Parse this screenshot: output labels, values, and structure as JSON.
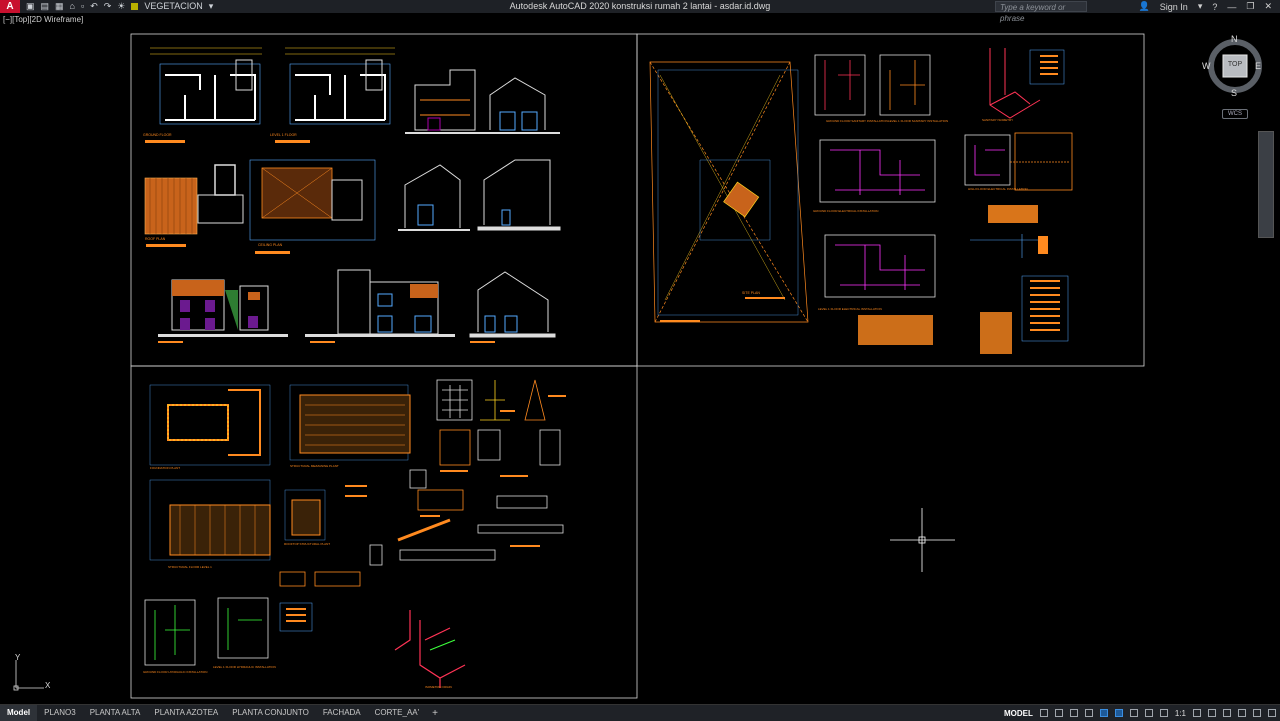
{
  "titlebar": {
    "app_letter": "A",
    "layer_name": "VEGETACION",
    "title": "Autodesk AutoCAD 2020    konstruksi rumah 2 lantai - asdar.id.dwg",
    "search_placeholder": "Type a keyword or phrase",
    "sign_in": "Sign In",
    "quick_access": [
      "▣",
      "▤",
      "▦",
      "⌂",
      "▫",
      "↶",
      "↷",
      "☀"
    ]
  },
  "viewport": {
    "label": "[−][Top][2D Wireframe]"
  },
  "viewcube": {
    "north": "N",
    "south": "S",
    "east": "E",
    "west": "W",
    "face": "TOP",
    "wcs": "WCS"
  },
  "ucs": {
    "x": "X",
    "y": "Y"
  },
  "sheet_labels": {
    "ground_floor": "GROUND FLOOR",
    "level1_floor": "LEVEL 1 FLOOR",
    "roof_plan": "ROOF PLAN",
    "ceiling_plan": "CEILING PLAN",
    "site_plan": "SITE PLAN",
    "gf_sanitary": "GROUND FLOOR SANITARY INSTALLATION",
    "l1_sanitary": "LEVEL 1 FLOOR SANITARY INSTALLATION",
    "gf_electrical": "GROUND FLOOR ELECTRICAL INSTALLATION",
    "l1_electrical": "LEVEL 1 FLOOR ELECTRICAL INSTALLATION",
    "hi_floor_electrical": "HIGH FLOOR ELECTRICAL INSTALLATION",
    "sanitary_iso": "SANITARY ISOMETRY",
    "foundation_plan": "FOUNDATION PLANT",
    "structural_mezz": "STRUCTURAL MEZZANINE PLANT",
    "structural_l1": "STRUCTURAL FLOOR LEVEL 1",
    "rooftop_structural": "ROOFTOP STRUCTURAL PLANT",
    "gf_hydraulic": "GROUND FLOOR HYDRAULIC INSTALLATION",
    "l1_hydraulic": "LEVEL 1 FLOOR HYDRAULIC INSTALLATION",
    "isometric_drain": "ISOMETRIC DRAIN"
  },
  "layout_tabs": [
    "Model",
    "PLANO3",
    "PLANTA ALTA",
    "PLANTA AZOTEA",
    "PLANTA CONJUNTO",
    "FACHADA",
    "CORTE_AA'"
  ],
  "tab_add": "+",
  "status": {
    "mode": "MODEL",
    "scale": "1:1"
  }
}
